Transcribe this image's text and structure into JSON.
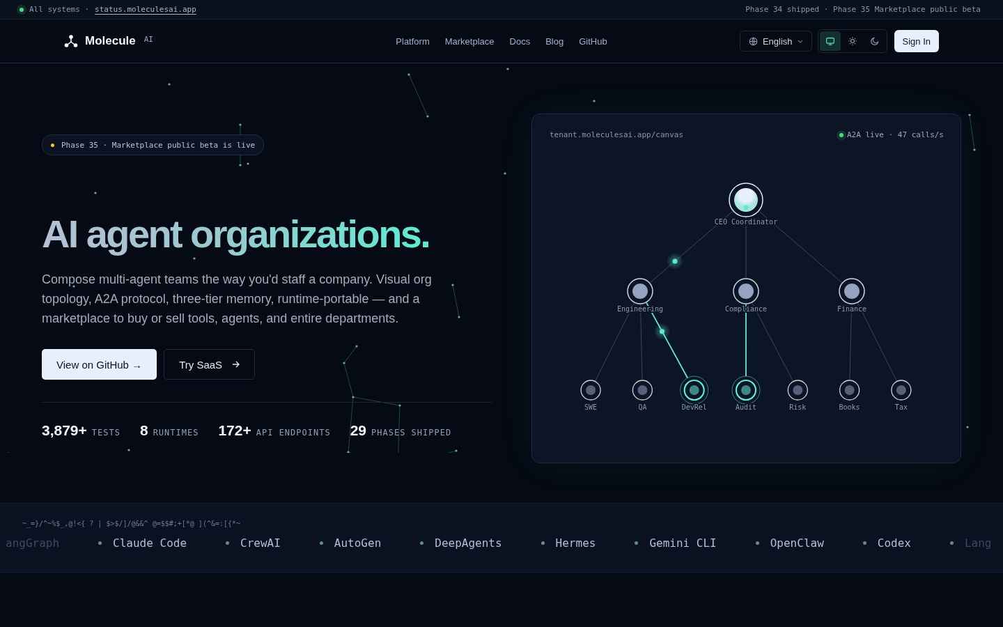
{
  "status_bar": {
    "status_text": "All systems ·",
    "link": "status.moleculesai.app",
    "announcement": "Phase 34 shipped · Phase 35 Marketplace public beta"
  },
  "header": {
    "logo": "Molecule",
    "logo_suffix": "AI",
    "nav": [
      "Platform",
      "Marketplace",
      "Docs",
      "Blog",
      "GitHub"
    ],
    "language": "English",
    "theme_options": [
      {
        "kind": "system",
        "selected": true
      },
      {
        "kind": "light",
        "selected": false
      },
      {
        "kind": "dark",
        "selected": false
      }
    ],
    "sign_in": "Sign In"
  },
  "hero": {
    "badge": "Phase 35 · Marketplace public beta is live",
    "title": "AI agent organizations.",
    "description": "Compose multi-agent teams the way you'd staff a company. Visual org topology, A2A protocol, three-tier memory, runtime-portable — and a marketplace to buy or sell tools, agents, and entire departments.",
    "buttons": [
      {
        "label": "View on GitHub →",
        "kind": "primary"
      },
      {
        "label": "Try SaaS",
        "kind": "secondary"
      }
    ],
    "stats": [
      {
        "value": "3,879+",
        "label": "TESTS"
      },
      {
        "value": "8",
        "label": "RUNTIMES"
      },
      {
        "value": "172+",
        "label": "API ENDPOINTS"
      },
      {
        "value": "29",
        "label": "PHASES SHIPPED"
      }
    ]
  },
  "canvas": {
    "url": "tenant.moleculesai.app/canvas",
    "live_status": "A2A live · 47 calls/s",
    "nodes": [
      {
        "label": "CEO Coordinator",
        "kind": "root",
        "active": false,
        "children": [
          {
            "label": "Engineering",
            "kind": "department",
            "active": false,
            "children": [
              {
                "label": "SWE",
                "kind": "agent",
                "active": false
              },
              {
                "label": "QA",
                "kind": "agent",
                "active": false
              },
              {
                "label": "DevRel",
                "kind": "agent",
                "active": true
              }
            ]
          },
          {
            "label": "Compliance",
            "kind": "department",
            "active": false,
            "children": [
              {
                "label": "Audit",
                "kind": "agent",
                "active": true
              },
              {
                "label": "Risk",
                "kind": "agent",
                "active": false
              }
            ]
          },
          {
            "label": "Finance",
            "kind": "department",
            "active": false,
            "children": [
              {
                "label": "Books",
                "kind": "agent",
                "active": false
              },
              {
                "label": "Tax",
                "kind": "agent",
                "active": false
              }
            ]
          }
        ]
      }
    ]
  },
  "ticker": {
    "glyphs": "~_=}/^~%$_,@!<{ ? | $>$/]/@&&^ @=$$#;+[*@ ](^&=:[{*~",
    "items": [
      "angGraph",
      "Claude Code",
      "CrewAI",
      "AutoGen",
      "DeepAgents",
      "Hermes",
      "Gemini CLI",
      "OpenClaw",
      "Codex",
      "Lang"
    ]
  }
}
